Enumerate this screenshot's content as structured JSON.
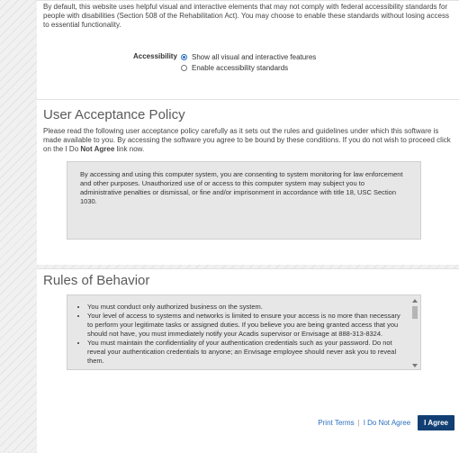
{
  "accessibility_panel": {
    "intro": "By default, this website uses helpful visual and interactive elements that may not comply with federal accessibility standards for people with disabilities (Section 508 of the Rehabilitation Act). You may choose to enable these standards without losing access to essential functionality.",
    "label": "Accessibility",
    "options": [
      "Show all visual and interactive features",
      "Enable accessibility standards"
    ],
    "selected_index": 0
  },
  "user_acceptance_policy": {
    "title": "User Acceptance Policy",
    "intro": "Please read the following user acceptance policy carefully as it sets out the rules and guidelines under which this software is made available to you. By accessing the software you agree to be bound by these conditions. If you do not wish to proceed click on the I Do ",
    "intro_bold": "Not Agree",
    "intro_end": " link now.",
    "box_text": "By accessing and using this computer system, you are consenting to system monitoring for law enforcement and other purposes. Unauthorized use of or access to this computer system may subject you to administrative penalties or dismissal, or fine and/or imprisonment in accordance with title 18, USC Section 1030."
  },
  "rules_of_behavior": {
    "title": "Rules of Behavior",
    "items": [
      "You must conduct only authorized business on the system.",
      "Your level of access to systems and networks is limited to ensure your access is no more than necessary to perform your legitimate tasks or assigned duties. If you believe you are being granted access that you should not have, you must immediately notify your Acadis supervisor or Envisage at 888-313-8324.",
      "You must maintain the confidentiality of your authentication credentials such as your password. Do not reveal your authentication credentials to anyone; an Envisage employee should never ask you to reveal them."
    ]
  },
  "footer": {
    "print_terms": "Print Terms",
    "separator": "|",
    "do_not_agree": "I Do Not Agree",
    "agree": "I Agree"
  },
  "colors": {
    "accent": "#2a6fbd",
    "agree_button": "#123f73"
  }
}
